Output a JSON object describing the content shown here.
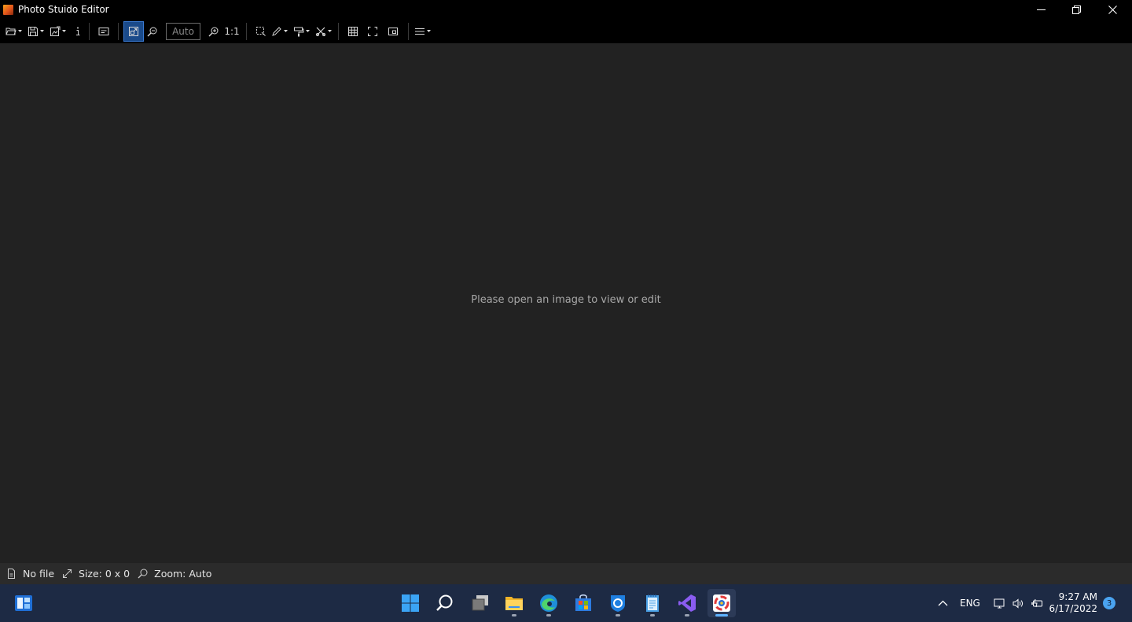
{
  "window": {
    "title": "Photo Stuido Editor",
    "icon": "app-logo-icon",
    "controls": [
      "minimize-icon",
      "restore-icon",
      "close-icon"
    ]
  },
  "toolbar": {
    "items": [
      "open-icon",
      "save-icon",
      "export-icon",
      "info-icon",
      "caption-icon",
      "fit-to-window-icon",
      "zoom-out-icon",
      "zoom-in-icon",
      "selection-icon",
      "draw-icon",
      "paint-icon",
      "tools-icon",
      "grid-icon",
      "fullscreen-icon",
      "frameless-icon",
      "menu-icon"
    ],
    "zoom_value": "Auto",
    "actual_size_label": "1:1"
  },
  "canvas": {
    "empty_message": "Please open an image to view or edit",
    "background": "#222222"
  },
  "statusbar": {
    "file": "No file",
    "size": "Size: 0 x 0",
    "zoom": "Zoom: Auto"
  },
  "taskbar": {
    "apps": [
      "widgets-icon",
      "start-icon",
      "search-icon",
      "task-view-icon",
      "file-explorer-icon",
      "edge-icon",
      "store-icon",
      "app-icon",
      "notepad-icon",
      "visual-studio-icon",
      "photo-studio-icon"
    ],
    "tray": {
      "language": "ENG",
      "time": "9:27 AM",
      "date": "6/17/2022",
      "notifications": "3"
    }
  },
  "colors": {
    "accent": "#3a7bd5",
    "taskbar": "#1d2a44",
    "statusbar": "#2b2b2b"
  }
}
